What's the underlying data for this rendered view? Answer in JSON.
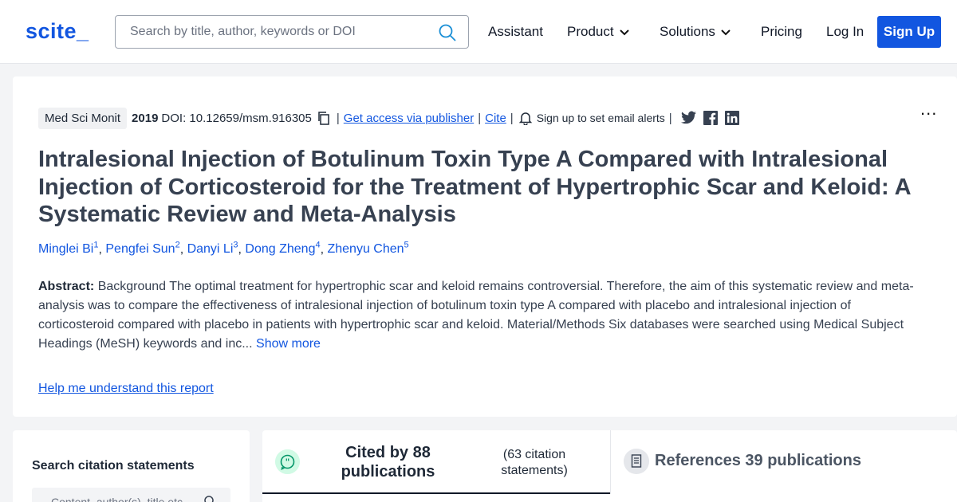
{
  "nav": {
    "logo": "scite_",
    "search_placeholder": "Search by title, author, keywords or DOI",
    "items": [
      "Assistant",
      "Product",
      "Solutions",
      "Pricing",
      "Log In"
    ],
    "signup": "Sign Up",
    "accent": "#1256e0"
  },
  "paper": {
    "journal": "Med Sci Monit",
    "year": "2019",
    "doi": "DOI: 10.12659/msm.916305",
    "access": "Get access via publisher",
    "cite": "Cite",
    "alerts": "Sign up to set email alerts",
    "title": "Intralesional Injection of Botulinum Toxin Type A Compared with Intralesional Injection of Corticosteroid for the Treatment of Hypertrophic Scar and Keloid: A Systematic Review and Meta-Analysis",
    "authors": [
      {
        "name": "Minglei Bi",
        "sup": "1"
      },
      {
        "name": "Pengfei Sun",
        "sup": "2"
      },
      {
        "name": "Danyi Li",
        "sup": "3"
      },
      {
        "name": "Dong Zheng",
        "sup": "4"
      },
      {
        "name": "Zhenyu Chen",
        "sup": "5"
      }
    ],
    "abstract_label": "Abstract:",
    "abstract_text": "Background The optimal treatment for hypertrophic scar and keloid remains controversial. Therefore, the aim of this systematic review and meta-analysis was to compare the effectiveness of intralesional injection of botulinum toxin type A compared with placebo and intralesional injection of corticosteroid compared with placebo in patients with hypertrophic scar and keloid. Material/Methods Six databases were searched using Medical Subject Headings (MeSH) keywords and inc...",
    "show_more": "Show more",
    "help_link": "Help me understand this report",
    "more_menu": "..."
  },
  "citation_search": {
    "label": "Search citation statements",
    "placeholder": "Content, author(s), title etc"
  },
  "tabs": {
    "cited_by": "Cited by 88 publications",
    "citation_statements": "(63 citation statements)",
    "references": "References 39 publications"
  }
}
